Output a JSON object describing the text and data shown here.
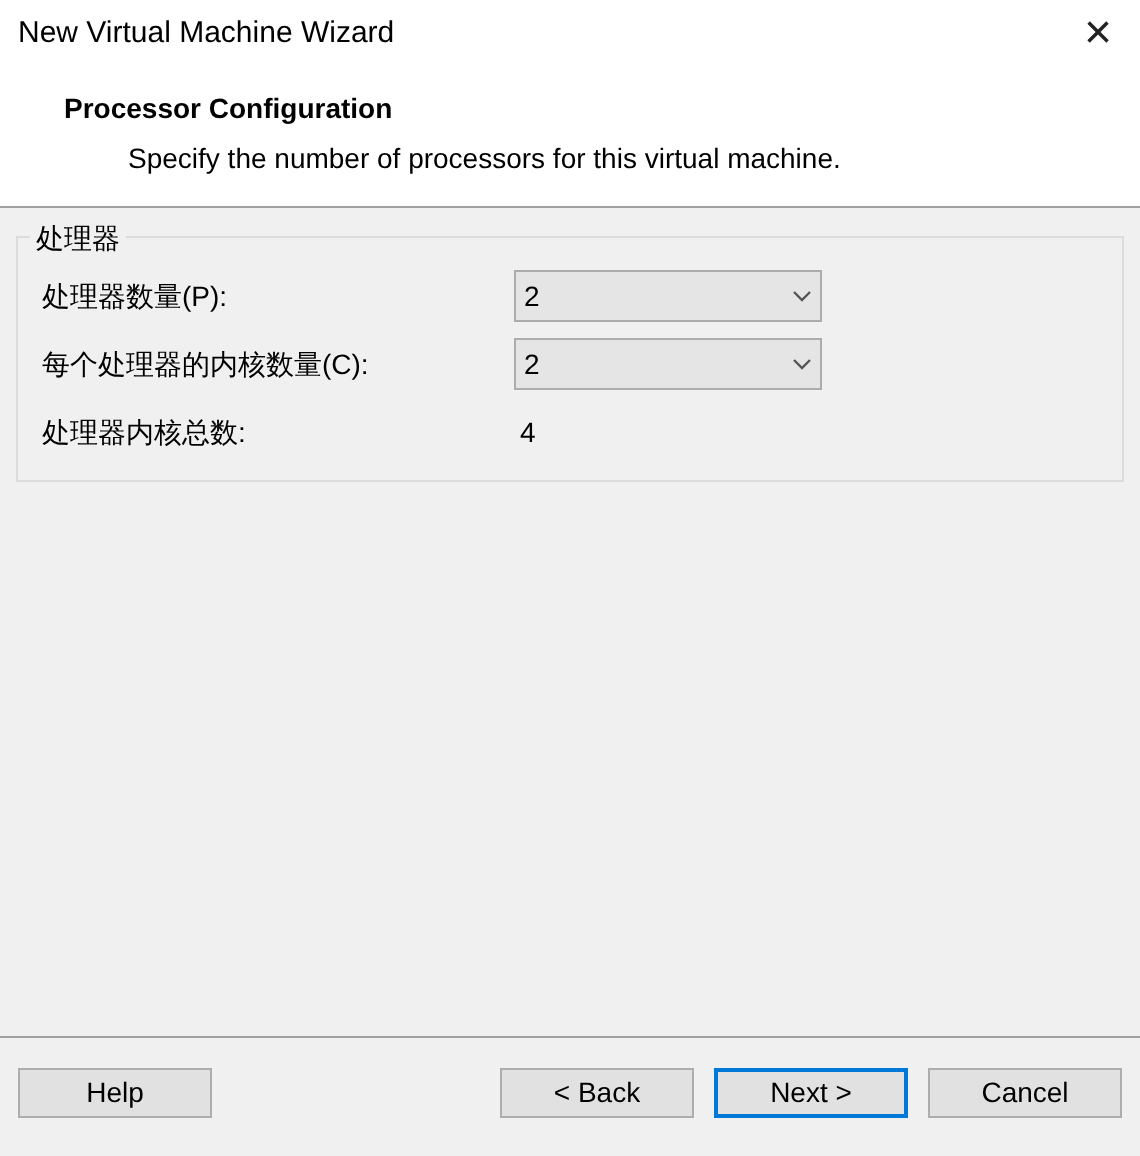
{
  "window": {
    "title": "New Virtual Machine Wizard",
    "close": "×"
  },
  "header": {
    "title": "Processor Configuration",
    "subtitle": "Specify the number of processors for this virtual machine."
  },
  "group": {
    "title": "处理器",
    "rows": [
      {
        "kind": "select",
        "label": "处理器数量(P):",
        "value": "2"
      },
      {
        "kind": "select",
        "label": "每个处理器的内核数量(C):",
        "value": "2"
      },
      {
        "kind": "text",
        "label": "处理器内核总数:",
        "value": "4"
      }
    ]
  },
  "buttons": [
    {
      "label": "Help",
      "default": false
    },
    {
      "label": "< Back",
      "default": false
    },
    {
      "label": "Next >",
      "default": true
    },
    {
      "label": "Cancel",
      "default": false
    }
  ]
}
